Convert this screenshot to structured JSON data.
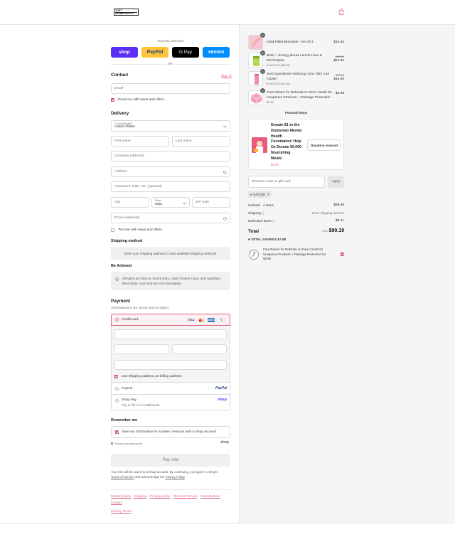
{
  "header": {
    "logo_line1": "JUST",
    "logo_line2": "INGREDIENTS",
    "cart_icon": "shopping-bag-icon"
  },
  "express": {
    "label": "Express checkout",
    "buttons": {
      "shop": "shop",
      "paypal": "PayPal",
      "gpay": "G Pay",
      "venmo": "venmo"
    },
    "or": "OR"
  },
  "contact": {
    "title": "Contact",
    "sign_in": "Sign in",
    "email_placeholder": "Email",
    "news_label": "Email me with news and offers"
  },
  "delivery": {
    "title": "Delivery",
    "country_label": "Country/Region",
    "country_value": "United States",
    "first_name": "First name",
    "last_name": "Last name",
    "company": "Company (optional)",
    "address": "Address",
    "apartment": "Apartment, suite, etc. (optional)",
    "city": "City",
    "state_label": "State",
    "state_value": "Iowa",
    "zip": "ZIP code",
    "phone": "Phone (optional)",
    "text_label": "Text me with news and offers"
  },
  "shipping": {
    "title": "Shipping method",
    "message": "Enter your shipping address to view available shipping methods."
  },
  "advised": {
    "title": "Be Advised",
    "message_line1": "All sales are final on Snack Bars, Clear Protein Cans, and Sparkling",
    "message_line2": "Electrolyte Cans and are non-refundable."
  },
  "payment": {
    "title": "Payment",
    "subtitle": "All transactions are secure and encrypted.",
    "credit_card": "Credit card",
    "card_icons": {
      "visa": "VISA",
      "mc": "MC",
      "amex": "AMEX",
      "more": "+1"
    },
    "billing_label": "Use shipping address as billing address",
    "paypal": "PayPal",
    "paypal_logo": "PayPal",
    "shop_pay": "Shop Pay",
    "shop_pay_sub": "Pay in full or in installments",
    "shop_logo": "shop"
  },
  "remember": {
    "title": "Remember me",
    "save_label": "Save my information for a faster checkout with a Shop account",
    "secure": "Secure and encrypted",
    "shop_logo": "shop"
  },
  "pay_now": "Pay now",
  "legal": {
    "line1": "Your info will be saved to a Shop account. By continuing, you agree to Shop's",
    "terms": "Terms of Service",
    "and": "and acknowledge the",
    "privacy": "Privacy Policy",
    "period": "."
  },
  "footer": {
    "links": [
      "Refund policy",
      "Shipping",
      "Privacy policy",
      "Terms of service",
      "Cancellations",
      "Contact",
      "Privacy Terms"
    ]
  },
  "order": {
    "items": [
      {
        "qty": "1",
        "name_line1": "Gold-Filled Bracelets - Set of 3",
        "name_line2": "",
        "discount": "",
        "compare": "",
        "price": "$15.00"
      },
      {
        "qty": "1",
        "name_line1": "Brain + Energy Boost Lemon Lime &",
        "name_line2": "Electrolytes",
        "discount": "KAYCEE (-$5.99)",
        "compare": "$59.99",
        "price": "$54.00"
      },
      {
        "qty": "1",
        "name_line1": "Just Ingredients HydroJug 12oz Slim Can",
        "name_line2": "Cooler",
        "discount": "KAYCEE (-$1.99)",
        "compare": "$19.99",
        "price": "$18.00"
      },
      {
        "qty": "1",
        "name_line1": "Free Return for Refunds or Store Credit On",
        "name_line2": "Unopened Products + Package Protection",
        "discount": "$2.98",
        "compare": "",
        "price": "$2.98"
      }
    ],
    "featured_title": "Featured items",
    "donation": {
      "line1": "Donate $1 to the",
      "line2": "Huntsman Mental",
      "line3": "Health",
      "line4": "Foundation! Help",
      "line5": "Us Donate 50,000",
      "line6": "Nourishing",
      "line7": "Meals!",
      "price": "$1.00",
      "button": "Donation Amount"
    },
    "discount_placeholder": "Discount code or gift card",
    "apply": "Apply",
    "code": "KAYCEE",
    "subtotal_label": "Subtotal · 4 items",
    "subtotal": "$89.98",
    "shipping_label": "Shipping",
    "shipping_value": "Enter shipping address",
    "taxes_label": "Estimated taxes",
    "taxes": "$0.21",
    "total_label": "Total",
    "currency": "USD",
    "total": "$90.19",
    "savings_label": "TOTAL SAVINGS",
    "savings": "$7.98",
    "protection_line1": "Free Return for Refunds or Store Credit On",
    "protection_line2": "Unopened Products + Package Protection for",
    "protection_line3": "$2.98"
  },
  "colors": {
    "accent": "#e0607e",
    "shop": "#5a31f4",
    "paypal": "#ffc439",
    "venmo": "#008cff",
    "gpay": "#000000"
  }
}
